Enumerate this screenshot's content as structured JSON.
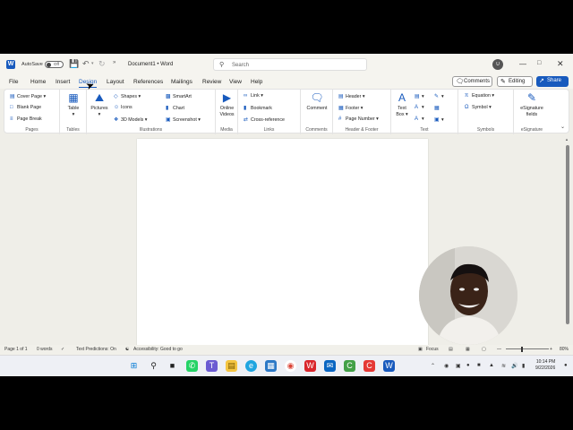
{
  "titlebar": {
    "autosave_label": "AutoSave",
    "autosave_state": "Off",
    "more": "»",
    "doc_title": "Document1 • Word",
    "search_placeholder": "Search",
    "user_initials": "U"
  },
  "tabs": [
    "File",
    "Home",
    "Insert",
    "Design",
    "Layout",
    "References",
    "Mailings",
    "Review",
    "View",
    "Help"
  ],
  "active_tab": "Design",
  "actions": {
    "comments": "Comments",
    "editing": "Editing",
    "share": "Share"
  },
  "ribbon": {
    "pages": {
      "label": "Pages",
      "cover_page": "Cover Page",
      "blank_page": "Blank Page",
      "page_break": "Page Break"
    },
    "tables": {
      "label": "Tables",
      "table": "Table"
    },
    "illustrations": {
      "label": "Illustrations",
      "pictures": "Pictures",
      "shapes": "Shapes",
      "icons": "Icons",
      "models": "3D Models",
      "smartart": "SmartArt",
      "chart": "Chart",
      "screenshot": "Screenshot"
    },
    "media": {
      "label": "Media",
      "online_videos_1": "Online",
      "online_videos_2": "Videos"
    },
    "links": {
      "label": "Links",
      "link": "Link",
      "bookmark": "Bookmark",
      "cross_reference": "Cross-reference"
    },
    "comments": {
      "label": "Comments",
      "comment": "Comment"
    },
    "header_footer": {
      "label": "Header & Footer",
      "header": "Header",
      "footer": "Footer",
      "page_number": "Page Number"
    },
    "text": {
      "label": "Text",
      "text_box_1": "Text",
      "text_box_2": "Box"
    },
    "symbols": {
      "label": "Symbols",
      "equation": "Equation",
      "symbol": "Symbol"
    },
    "esignature": {
      "label": "eSignature",
      "esig_1": "eSignature",
      "esig_2": "fields"
    }
  },
  "status": {
    "page": "Page 1 of 1",
    "words": "0 words",
    "text_predictions": "Text Predictions: On",
    "accessibility": "Accessibility: Good to go",
    "focus": "Focus",
    "zoom": "80%"
  },
  "taskbar": {
    "time": "10:14 PM",
    "date": "9/22/2026"
  },
  "colors": {
    "accent": "#185abd",
    "background": "#efeee8"
  }
}
